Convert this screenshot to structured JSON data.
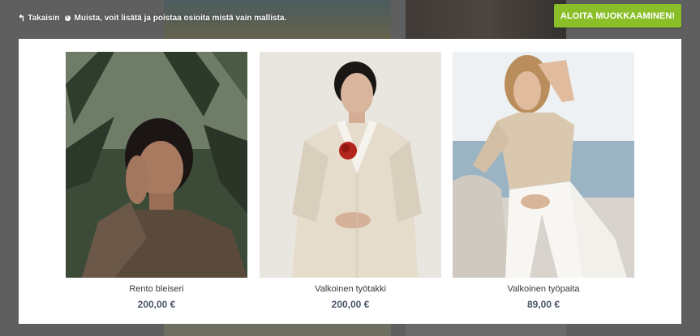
{
  "topbar": {
    "back_label": "Takaisin",
    "hint": "Muista, voit lisätä ja poistaa osioita mistä vain mallista.",
    "start_button": "ALOITA MUOKKAAMINEN!"
  },
  "colors": {
    "accent": "#8bbf2a",
    "price": "#4a5565"
  },
  "products": [
    {
      "name": "Rento bleiseri",
      "price": "200,00 €"
    },
    {
      "name": "Valkoinen työtakki",
      "price": "200,00 €"
    },
    {
      "name": "Valkoinen työpaita",
      "price": "89,00 €"
    }
  ]
}
